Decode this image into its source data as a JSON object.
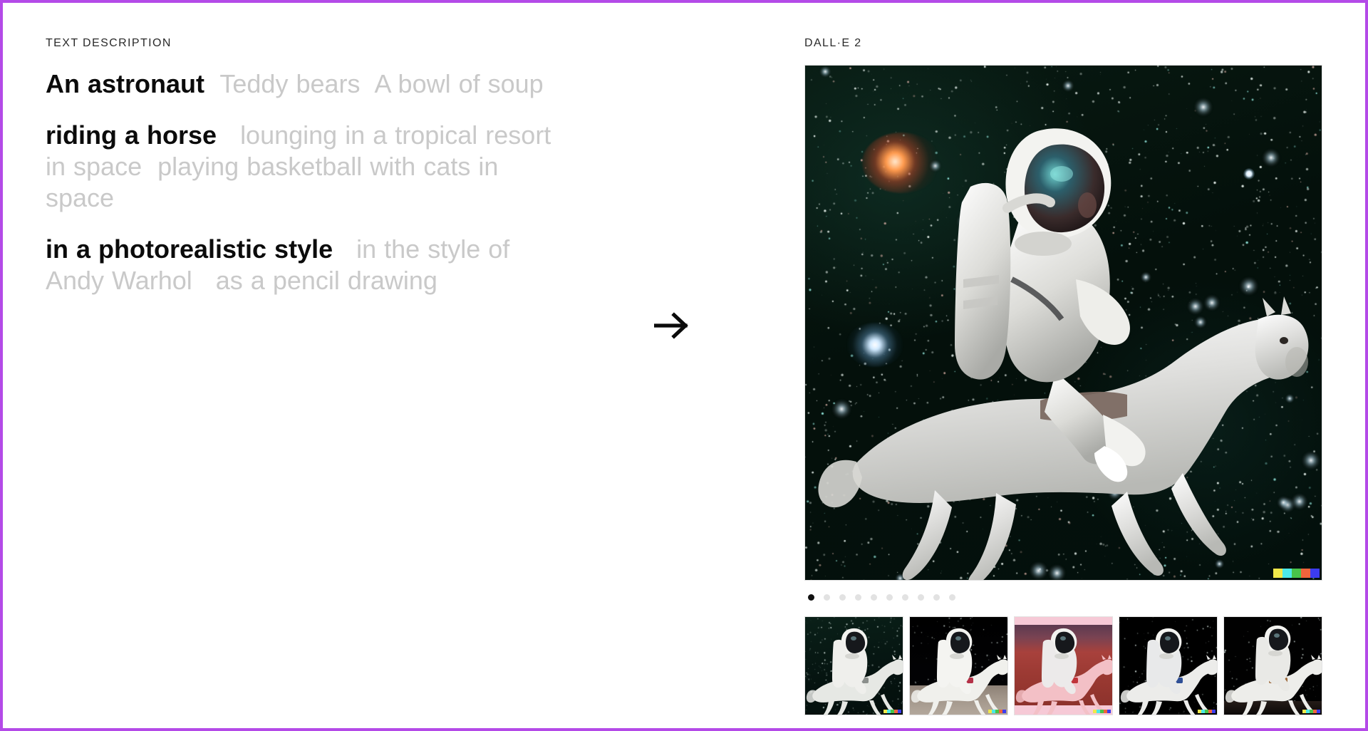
{
  "frame": {
    "accent_border_color": "#b44ae8"
  },
  "left": {
    "section_label": "TEXT DESCRIPTION",
    "prompt_groups": [
      {
        "id": "subject",
        "selected": "An astronaut",
        "alternatives": [
          "Teddy bears",
          "A bowl of soup"
        ]
      },
      {
        "id": "action",
        "selected": "riding a horse",
        "alternatives": [
          "lounging in a tropical resort in space",
          "playing basketball with cats in space"
        ]
      },
      {
        "id": "style",
        "selected": "in a photorealistic style",
        "alternatives": [
          "in the style of Andy Warhol",
          "as a pencil drawing"
        ]
      }
    ]
  },
  "arrow": {
    "icon": "arrow-right-icon",
    "glyph": "→"
  },
  "right": {
    "label": "DALL·E 2",
    "hero": {
      "alt": "An astronaut riding a horse in space, photorealistic",
      "signature_colors": [
        "#f0e84a",
        "#4ce8e8",
        "#48c44a",
        "#f0643c",
        "#3c3cf0"
      ]
    },
    "pagination": {
      "total": 10,
      "active_index": 0
    },
    "thumbnails": [
      {
        "id": "thumb-1",
        "alt": "astronaut on white horse in green starfield",
        "scene": "t-space-green"
      },
      {
        "id": "thumb-2",
        "alt": "astronaut on white horse on lunar surface",
        "scene": "t-moon-night"
      },
      {
        "id": "thumb-3",
        "alt": "astronaut on pink horse on red mars landscape",
        "scene": "t-mars-pink"
      },
      {
        "id": "thumb-4",
        "alt": "astronaut in blue suit on white horse on black background",
        "scene": "t-dark"
      },
      {
        "id": "thumb-5",
        "alt": "astronaut on rearing white horse on black background",
        "scene": "t-dark2"
      }
    ]
  }
}
